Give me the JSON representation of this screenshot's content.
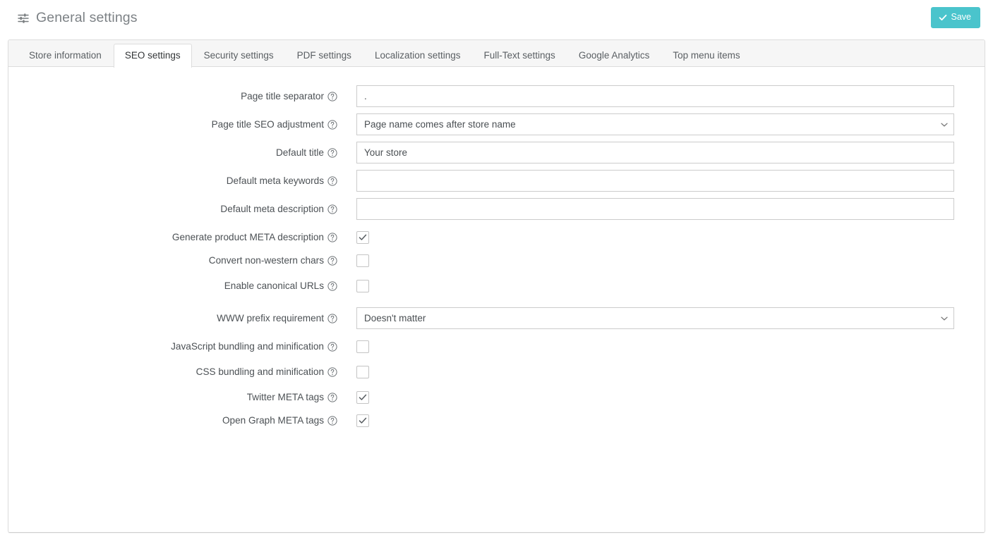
{
  "header": {
    "title": "General settings",
    "icon": "sliders-icon",
    "save_label": "Save",
    "save_icon": "check-icon",
    "save_color": "#4ac4cc"
  },
  "tabs": [
    {
      "label": "Store information",
      "active": false
    },
    {
      "label": "SEO settings",
      "active": true
    },
    {
      "label": "Security settings",
      "active": false
    },
    {
      "label": "PDF settings",
      "active": false
    },
    {
      "label": "Localization settings",
      "active": false
    },
    {
      "label": "Full-Text settings",
      "active": false
    },
    {
      "label": "Google Analytics",
      "active": false
    },
    {
      "label": "Top menu items",
      "active": false
    }
  ],
  "form": {
    "help_icon": "help-circle-icon",
    "fields": [
      {
        "label": "Page title separator",
        "type": "text",
        "value": ".",
        "placeholder": ""
      },
      {
        "label": "Page title SEO adjustment",
        "type": "select",
        "value": "Page name comes after store name"
      },
      {
        "label": "Default title",
        "type": "text",
        "value": "Your store",
        "placeholder": ""
      },
      {
        "label": "Default meta keywords",
        "type": "text",
        "value": "",
        "placeholder": ""
      },
      {
        "label": "Default meta description",
        "type": "text",
        "value": "",
        "placeholder": ""
      },
      {
        "label": "Generate product META description",
        "type": "checkbox",
        "checked": true
      },
      {
        "label": "Convert non-western chars",
        "type": "checkbox",
        "checked": false
      },
      {
        "label": "Enable canonical URLs",
        "type": "checkbox",
        "checked": false
      },
      {
        "label": "WWW prefix requirement",
        "type": "select",
        "value": "Doesn't matter"
      },
      {
        "label": "JavaScript bundling and minification",
        "type": "checkbox",
        "checked": false
      },
      {
        "label": "CSS bundling and minification",
        "type": "checkbox",
        "checked": false
      },
      {
        "label": "Twitter META tags",
        "type": "checkbox",
        "checked": true
      },
      {
        "label": "Open Graph META tags",
        "type": "checkbox",
        "checked": true
      }
    ]
  }
}
